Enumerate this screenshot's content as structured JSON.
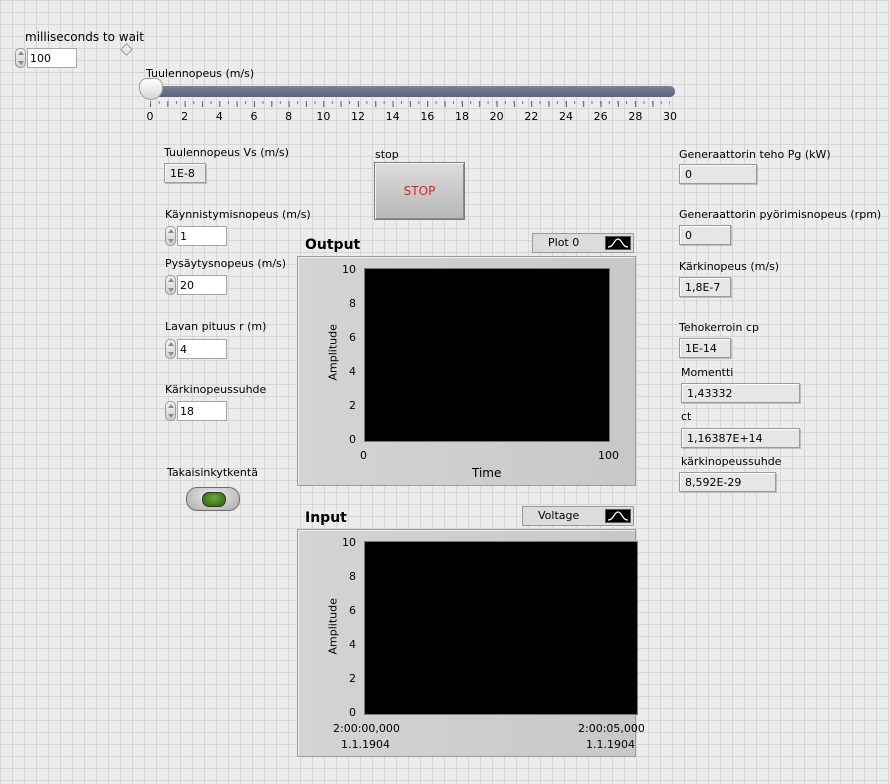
{
  "wait": {
    "label": "milliseconds to wait",
    "value": "100"
  },
  "slider": {
    "label": "Tuulennopeus (m/s)",
    "value": 0,
    "min": 0,
    "max": 30,
    "ticks": [
      "0",
      "2",
      "4",
      "6",
      "8",
      "10",
      "12",
      "14",
      "16",
      "18",
      "20",
      "22",
      "24",
      "26",
      "28",
      "30"
    ]
  },
  "left": {
    "vs_label": "Tuulennopeus Vs (m/s)",
    "vs_value": "1E-8",
    "start_label": "Käynnistymisnopeus (m/s)",
    "start_value": "1",
    "stop_speed_label": "Pysäytysnopeus (m/s)",
    "stop_speed_value": "20",
    "blade_label": "Lavan pituus r (m)",
    "blade_value": "4",
    "tsr_label": "Kärkinopeussuhde",
    "tsr_value": "18",
    "feedback_label": "Takaisinkytkentä"
  },
  "stop": {
    "label": "stop",
    "button": "STOP"
  },
  "output_graph": {
    "title": "Output",
    "legend": "Plot 0",
    "ylabel": "Amplitude",
    "xlabel": "Time",
    "yticks": [
      "10",
      "8",
      "6",
      "4",
      "2",
      "0"
    ],
    "xticks": [
      "0",
      "100"
    ]
  },
  "input_graph": {
    "title": "Input",
    "legend": "Voltage",
    "ylabel": "Amplitude",
    "yticks": [
      "10",
      "8",
      "6",
      "4",
      "2",
      "0"
    ],
    "x_start_time": "2:00:00,000",
    "x_start_date": "1.1.1904",
    "x_end_time": "2:00:05,000",
    "x_end_date": "1.1.1904"
  },
  "right": {
    "pg_label": "Generaattorin teho Pg (kW)",
    "pg_value": "0",
    "rpm_label": "Generaattorin pyörimisnopeus (rpm)",
    "rpm_value": "0",
    "tip_label": "Kärkinopeus (m/s)",
    "tip_value": "1,8E-7",
    "cp_label": "Tehokerroin cp",
    "cp_value": "1E-14",
    "moment_label": "Momentti",
    "moment_value": "1,43332",
    "ct_label": "ct",
    "ct_value": "1,16387E+14",
    "tsr_label": "kärkinopeussuhde",
    "tsr_value": "8,592E-29"
  },
  "colors": {
    "led": "#3f7d1e",
    "stop_text": "#e02020"
  }
}
